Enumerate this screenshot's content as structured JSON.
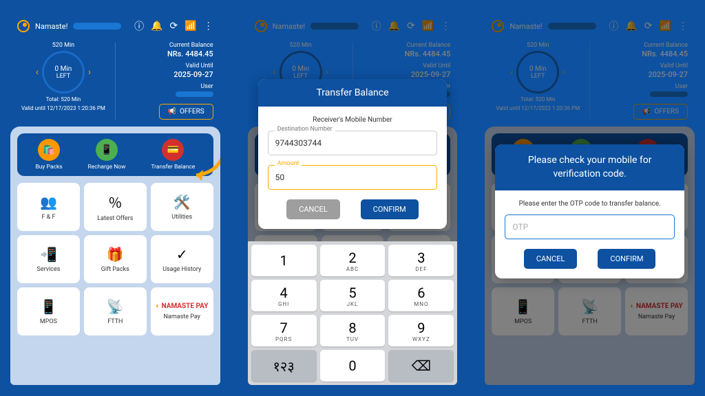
{
  "greeting": "Namaste!",
  "balance": {
    "current_label": "Current Balance",
    "current_value": "NRs. 4484.45",
    "valid_label": "Valid Until",
    "valid_value": "2025-09-27",
    "user_label": "User"
  },
  "dial": {
    "top": "520 Min",
    "value": "0 Min",
    "left": "LEFT",
    "total": "Total: 520  Min",
    "valid": "Valid until 12/17/2023 1:20:36 PM"
  },
  "offers_btn": "OFFERS",
  "actions": [
    {
      "label": "Buy Packs",
      "icon": "🛍️",
      "name": "buy-packs"
    },
    {
      "label": "Recharge Now",
      "icon": "📱",
      "name": "recharge-now"
    },
    {
      "label": "Transfer Balance",
      "icon": "💳",
      "name": "transfer-balance"
    }
  ],
  "tiles": [
    {
      "label": "F & F",
      "icon": "👥",
      "name": "fnf"
    },
    {
      "label": "Latest Offers",
      "icon": "％",
      "name": "latest-offers"
    },
    {
      "label": "Utilities",
      "icon": "🛠️",
      "name": "utilities"
    },
    {
      "label": "Services",
      "icon": "📲",
      "name": "services"
    },
    {
      "label": "Gift Packs",
      "icon": "🎁",
      "name": "gift-packs"
    },
    {
      "label": "Usage History",
      "icon": "✓",
      "name": "usage-history"
    },
    {
      "label": "MPOS",
      "icon": "📱",
      "name": "mpos"
    },
    {
      "label": "FTTH",
      "icon": "📡",
      "name": "ftth"
    },
    {
      "label": "Namaste Pay",
      "icon": "NAMASTE PAY",
      "name": "namaste-pay",
      "np": true
    }
  ],
  "transfer_modal": {
    "title": "Transfer Balance",
    "subtitle": "Receiver's Mobile Number",
    "dest_label": "Destination Number",
    "dest_value": "9744303744",
    "amount_label": "Amount",
    "amount_value": "50",
    "cancel": "CANCEL",
    "confirm": "CONFIRM"
  },
  "otp_modal": {
    "title": "Please check your mobile for verification code.",
    "subtitle": "Please enter the OTP code to transfer balance.",
    "placeholder": "OTP",
    "cancel": "CANCEL",
    "confirm": "CONFIRM"
  },
  "keypad": [
    {
      "n": "1",
      "l": ""
    },
    {
      "n": "2",
      "l": "ABC"
    },
    {
      "n": "3",
      "l": "DEF"
    },
    {
      "n": "4",
      "l": "GHI"
    },
    {
      "n": "5",
      "l": "JKL"
    },
    {
      "n": "6",
      "l": "MNO"
    },
    {
      "n": "7",
      "l": "PQRS"
    },
    {
      "n": "8",
      "l": "TUV"
    },
    {
      "n": "9",
      "l": "WXYZ"
    },
    {
      "n": "१२३",
      "l": "",
      "gray": true
    },
    {
      "n": "0",
      "l": ""
    },
    {
      "n": "⌫",
      "l": "",
      "gray": true
    }
  ],
  "colors": {
    "primary": "#0d51a0",
    "accent": "#ffa800"
  }
}
